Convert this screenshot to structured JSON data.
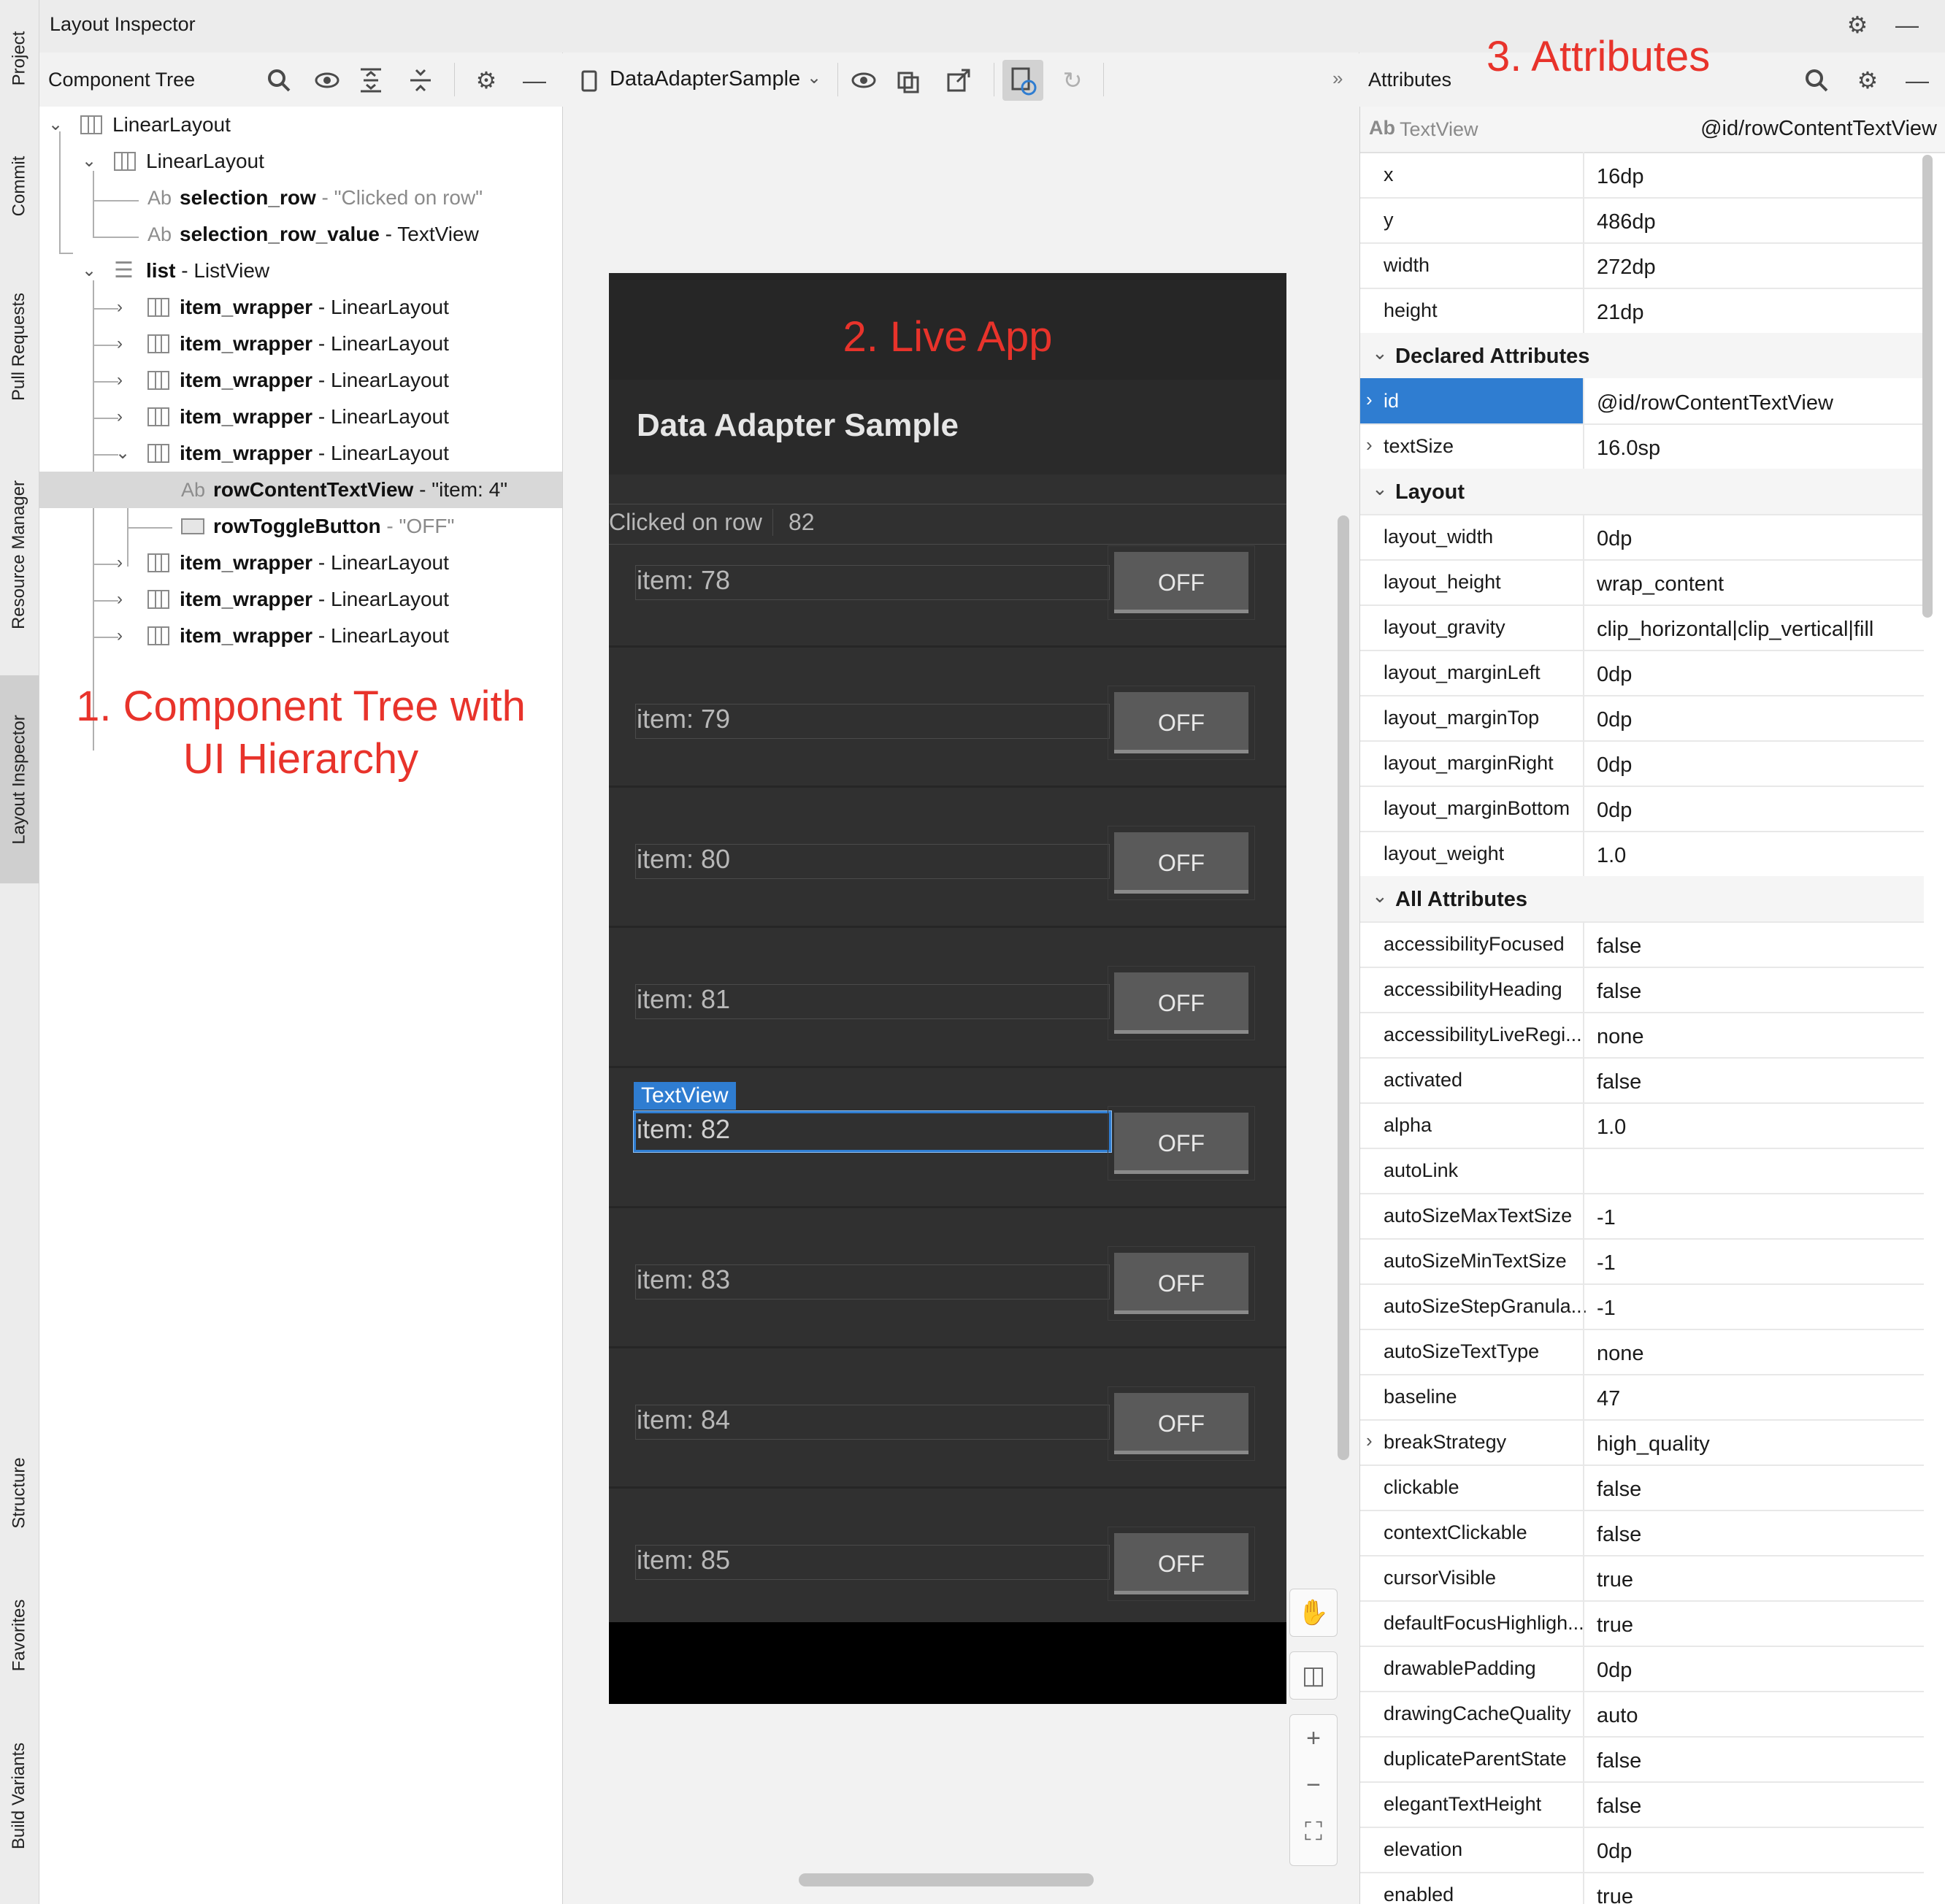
{
  "window": {
    "title": "Layout Inspector"
  },
  "left_tool_tabs": [
    {
      "label": "Project",
      "icon": "folder-icon"
    },
    {
      "label": "Commit",
      "icon": "commit-icon"
    },
    {
      "label": "Pull Requests",
      "icon": "pull-request-icon"
    },
    {
      "label": "Resource Manager",
      "icon": "resource-icon"
    },
    {
      "label": "Layout Inspector",
      "icon": "layout-inspector-icon",
      "active": true
    },
    {
      "label": "Structure",
      "icon": "structure-icon"
    },
    {
      "label": "Favorites",
      "icon": "star-icon"
    },
    {
      "label": "Build Variants",
      "icon": "build-variants-icon"
    }
  ],
  "component_tree": {
    "title": "Component Tree",
    "annotation": "1. Component Tree with UI Hierarchy",
    "annotation_line1": "1. Component Tree with",
    "annotation_line2": "UI Hierarchy",
    "rows": [
      {
        "name": "LinearLayout",
        "type": ""
      },
      {
        "name": "LinearLayout",
        "type": ""
      },
      {
        "name": "selection_row",
        "type": " - \"Clicked on row\""
      },
      {
        "name": "selection_row_value",
        "type": " - TextView"
      },
      {
        "name": "list",
        "type": " - ListView"
      },
      {
        "name": "item_wrapper",
        "type": " - LinearLayout"
      },
      {
        "name": "item_wrapper",
        "type": " - LinearLayout"
      },
      {
        "name": "item_wrapper",
        "type": " - LinearLayout"
      },
      {
        "name": "item_wrapper",
        "type": " - LinearLayout"
      },
      {
        "name": "item_wrapper",
        "type": " - LinearLayout"
      },
      {
        "name": "rowContentTextView",
        "type": " - \"item: 4\""
      },
      {
        "name": "rowToggleButton",
        "type": " - \"OFF\""
      },
      {
        "name": "item_wrapper",
        "type": " - LinearLayout"
      },
      {
        "name": "item_wrapper",
        "type": " - LinearLayout"
      },
      {
        "name": "item_wrapper",
        "type": " - LinearLayout"
      }
    ],
    "text_icon_label": "Ab"
  },
  "device_toolbar": {
    "process": "DataAdapterSample",
    "overflow": "»"
  },
  "live_app": {
    "annotation": "2. Live App",
    "app_title": "Data Adapter Sample",
    "selection_label": "Clicked on row",
    "selection_value": "82",
    "highlight_label": "TextView",
    "button_label": "OFF",
    "items": [
      "item: 78",
      "item: 79",
      "item: 80",
      "item: 81",
      "item: 82",
      "item: 83",
      "item: 84",
      "item: 85"
    ]
  },
  "attributes": {
    "title": "Attributes",
    "annotation": "3. Attributes",
    "view_type": "TextView",
    "view_id": "@id/rowContentTextView",
    "text_icon_label": "Ab",
    "top": [
      {
        "k": "x",
        "v": "16dp"
      },
      {
        "k": "y",
        "v": "486dp"
      },
      {
        "k": "width",
        "v": "272dp"
      },
      {
        "k": "height",
        "v": "21dp"
      }
    ],
    "declared_title": "Declared Attributes",
    "declared": [
      {
        "k": "id",
        "v": "@id/rowContentTextView"
      },
      {
        "k": "textSize",
        "v": "16.0sp"
      }
    ],
    "layout_title": "Layout",
    "layout": [
      {
        "k": "layout_width",
        "v": "0dp"
      },
      {
        "k": "layout_height",
        "v": "wrap_content"
      },
      {
        "k": "layout_gravity",
        "v": "clip_horizontal|clip_vertical|fill"
      },
      {
        "k": "layout_marginLeft",
        "v": "0dp"
      },
      {
        "k": "layout_marginTop",
        "v": "0dp"
      },
      {
        "k": "layout_marginRight",
        "v": "0dp"
      },
      {
        "k": "layout_marginBottom",
        "v": "0dp"
      },
      {
        "k": "layout_weight",
        "v": "1.0"
      }
    ],
    "all_title": "All Attributes",
    "all": [
      {
        "k": "accessibilityFocused",
        "v": "false"
      },
      {
        "k": "accessibilityHeading",
        "v": "false"
      },
      {
        "k": "accessibilityLiveRegi...",
        "v": "none"
      },
      {
        "k": "activated",
        "v": "false"
      },
      {
        "k": "alpha",
        "v": "1.0"
      },
      {
        "k": "autoLink",
        "v": ""
      },
      {
        "k": "autoSizeMaxTextSize",
        "v": "-1"
      },
      {
        "k": "autoSizeMinTextSize",
        "v": "-1"
      },
      {
        "k": "autoSizeStepGranula...",
        "v": "-1"
      },
      {
        "k": "autoSizeTextType",
        "v": "none"
      },
      {
        "k": "baseline",
        "v": "47"
      },
      {
        "k": "breakStrategy",
        "v": "high_quality"
      },
      {
        "k": "clickable",
        "v": "false"
      },
      {
        "k": "contextClickable",
        "v": "false"
      },
      {
        "k": "cursorVisible",
        "v": "true"
      },
      {
        "k": "defaultFocusHighligh...",
        "v": "true"
      },
      {
        "k": "drawablePadding",
        "v": "0dp"
      },
      {
        "k": "drawingCacheQuality",
        "v": "auto"
      },
      {
        "k": "duplicateParentState",
        "v": "false"
      },
      {
        "k": "elegantTextHeight",
        "v": "false"
      },
      {
        "k": "elevation",
        "v": "0dp"
      },
      {
        "k": "enabled",
        "v": "true"
      }
    ]
  },
  "colors": {
    "annotation": "#e8332b",
    "selection": "#2f7dd1",
    "app_bg": "#303030"
  }
}
